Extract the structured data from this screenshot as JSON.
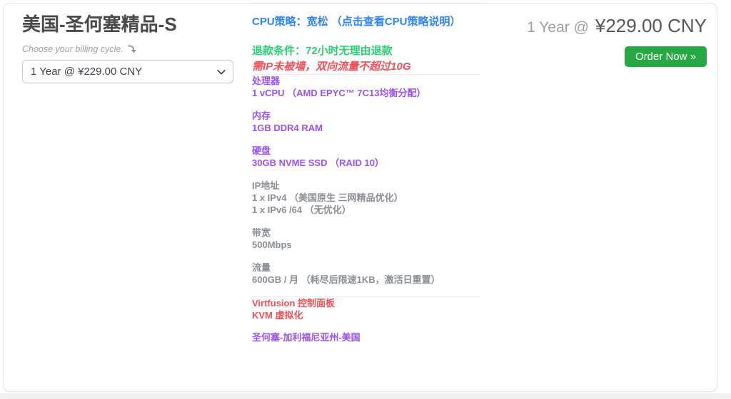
{
  "card": {
    "title": "美国-圣何塞精品-S",
    "billing": {
      "hint": "Choose your billing cycle.",
      "selected_option": "1 Year @ ¥229.00 CNY"
    },
    "pricing": {
      "term": "1 Year @",
      "price": "¥229.00 CNY",
      "order_button_label": "Order Now »"
    },
    "details": {
      "cpu_policy_link": "CPU策略：宽松 （点击查看CPU策略说明）",
      "refund_policy": "退款条件：72小时无理由退款",
      "refund_condition": "需IP未被墙，双向流量不超过10G",
      "specs": [
        {
          "label": "处理器",
          "lines": [
            "1 vCPU （AMD EPYC™ 7C13均衡分配）"
          ],
          "color": "purple"
        },
        {
          "label": "内存",
          "lines": [
            "1GB DDR4 RAM"
          ],
          "color": "purple"
        },
        {
          "label": "硬盘",
          "lines": [
            "30GB NVME SSD （RAID 10）"
          ],
          "color": "purple"
        },
        {
          "label": "IP地址",
          "lines": [
            "1 x IPv4 （美国原生 三网精品优化）",
            "1 x IPv6 /64 （无优化）"
          ],
          "color": "gray"
        },
        {
          "label": "带宽",
          "lines": [
            "500Mbps"
          ],
          "color": "gray"
        },
        {
          "label": "流量",
          "lines": [
            "600GB / 月 （耗尽后限速1KB，激活日重置）"
          ],
          "color": "gray"
        }
      ],
      "platform_lines": [
        "Virtfusion 控制面板",
        "KVM 虚拟化"
      ],
      "location": "圣何塞-加利福尼亚州-美国"
    }
  },
  "icons": {
    "billing_pointer": "curved-down-arrow",
    "select_chevron": "chevron-down",
    "order_arrows": "double-angle-right"
  },
  "colors": {
    "link_blue": "#2e86f5",
    "success_green": "#2dce71",
    "warning_red": "#f25058",
    "spec_purple": "#9b51f0",
    "spec_gray": "#8a8f94",
    "button_green": "#28a745"
  }
}
